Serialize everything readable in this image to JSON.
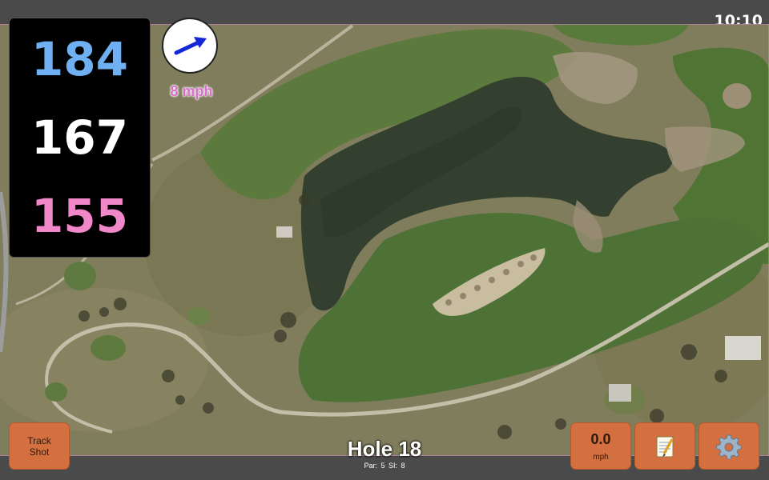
{
  "status_bar": {
    "time": "10:10"
  },
  "distances": {
    "back": "184",
    "middle": "167",
    "front": "155"
  },
  "wind": {
    "speed_label": "8 mph",
    "direction_icon": "arrow-icon"
  },
  "buttons": {
    "track_shot": "Track\nShot",
    "wind_value": "0.0",
    "wind_unit": "mph",
    "notes_icon": "notepad-icon",
    "settings_icon": "gear-icon"
  },
  "hole": {
    "title": "Hole 18",
    "par_label": "Par: 5",
    "si_label": "SI: 8"
  },
  "colors": {
    "back_distance": "#6fb0f2",
    "middle_distance": "#ffffff",
    "front_distance": "#f087c8",
    "button": "#d4703f",
    "wind_text": "#d86fcf"
  }
}
